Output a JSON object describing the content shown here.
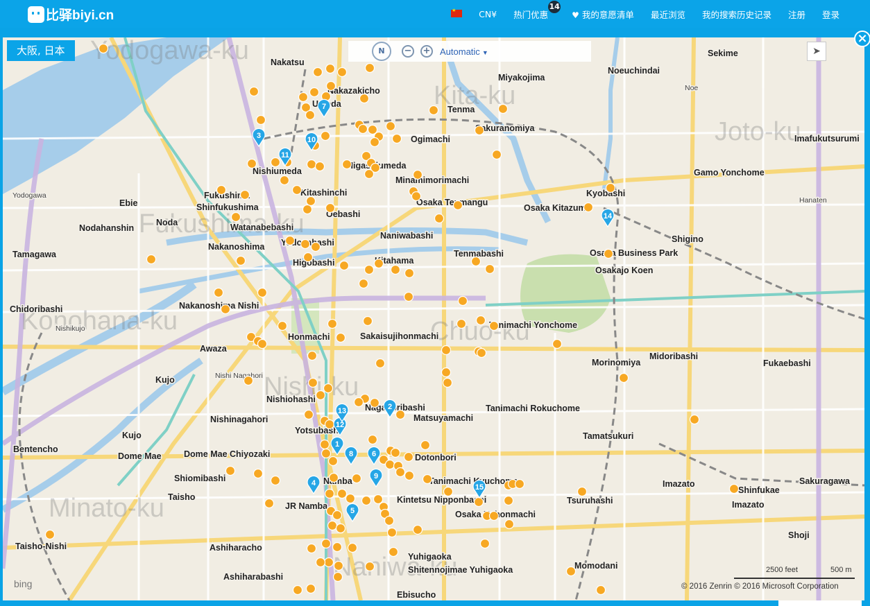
{
  "header": {
    "logo_text": "比驿biyi.cn",
    "currency": "CN¥",
    "deals_label": "热门优惠",
    "deals_badge": "14",
    "wishlist_label": "我的意愿清单",
    "recent_label": "最近浏览",
    "history_label": "我的搜索历史记录",
    "register_label": "注册",
    "login_label": "登录"
  },
  "map": {
    "city_tag": "大阪, 日本",
    "compass_label": "N",
    "zoom_out": "−",
    "zoom_in": "+",
    "style_label": "Automatic",
    "close": "×",
    "attribution": "© 2016 Zenrin    © 2016 Microsoft Corporation",
    "bing": "bing",
    "scale_feet": "2500 feet",
    "scale_m": "500 m",
    "colors": {
      "water": "#a6cdea",
      "park": "#c9dfae",
      "land": "#f1ede3",
      "marker": "#f7a823",
      "pin": "#26a6e6"
    },
    "ward_labels": [
      "Yodogawa-ku",
      "Kita-ku",
      "Joto-ku",
      "Fukushima-ku",
      "Konohana-ku",
      "Chuo-ku",
      "Nishi-ku",
      "Minato-ku",
      "Naniwa-ku"
    ],
    "places": [
      "Nakatsu",
      "Nakazakicho",
      "Miyakojima",
      "Noeuchindai",
      "Sekime",
      "Noe",
      "Umeda",
      "Tenma",
      "Ogimachi",
      "Sakuranomiya",
      "Imafukutsurumi",
      "Nishiumeda",
      "Higashiumeda",
      "Minamimorimachi",
      "Gamo Yonchome",
      "Fukushima",
      "Kitashinchi",
      "Osaka Tenmangu",
      "Kyobashi",
      "Yodogawa",
      "Ebie",
      "Shinfukushima",
      "Oebashi",
      "Naniwabashi",
      "Osaka Kitazume",
      "Noda",
      "Watanabebashi",
      "Nodahanshin",
      "Nakanoshima",
      "Yodoyabashi",
      "Kitahama",
      "Shigino",
      "Higobashi",
      "Tenmabashi",
      "Osaka Business Park",
      "Tamagawa",
      "Osakajo Koen",
      "Hanaten",
      "Nakanoshima Nishi",
      "Honmachi",
      "Tanimachi Yonchome",
      "Chidoribashi",
      "Nishikujo",
      "Sakaisujihonmachi",
      "Awaza",
      "Morinomiya",
      "Midoribashi",
      "Fukaebashi",
      "Nishi Nagahori",
      "Kujo",
      "Nishiohashi",
      "Nagahoribashi",
      "Tanimachi Rokuchome",
      "Nishinagahori",
      "Matsuyamachi",
      "Yotsubashi",
      "Kujo",
      "Tamatsukuri",
      "Dome Mae",
      "Dome Mae Chiyozaki",
      "Dotonbori",
      "Bentencho",
      "Shiomibashi",
      "Namba",
      "Tanimachi Kyuchome",
      "Imazato",
      "Shinfukae",
      "Taisho",
      "Sakuragawa",
      "JR Namba",
      "Kintetsu Nipponbashi",
      "Tsuruhashi",
      "Osaka Uehonmachi",
      "Imazato",
      "Shoji",
      "Ashiharacho",
      "Taisho-Nishi",
      "Ashiharabashi",
      "Yuhigaoka",
      "Shitennojimae Yuhigaoka",
      "Momodani",
      "Ebisucho"
    ],
    "pins": [
      "1",
      "2",
      "3",
      "4",
      "5",
      "6",
      "7",
      "8",
      "9",
      "10",
      "11",
      "12",
      "13",
      "14",
      "15"
    ]
  }
}
